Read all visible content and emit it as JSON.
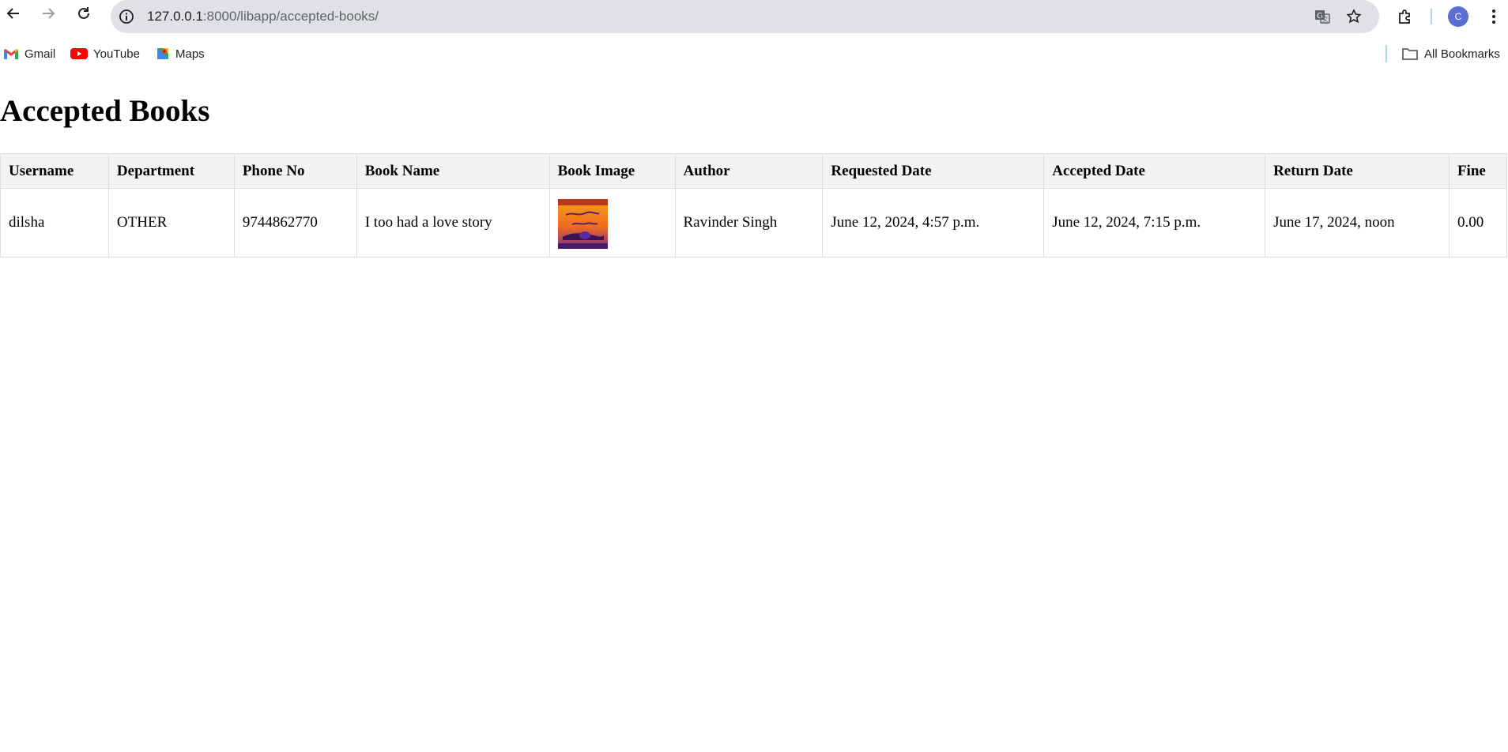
{
  "browser": {
    "url_host": "127.0.0.1",
    "url_path": ":8000/libapp/accepted-books/",
    "avatar_letter": "C",
    "bookmarks": [
      {
        "label": "Gmail",
        "icon": "gmail-icon"
      },
      {
        "label": "YouTube",
        "icon": "youtube-icon"
      },
      {
        "label": "Maps",
        "icon": "maps-icon"
      }
    ],
    "all_bookmarks_label": "All Bookmarks"
  },
  "page": {
    "title": "Accepted Books",
    "table": {
      "headers": [
        "Username",
        "Department",
        "Phone No",
        "Book Name",
        "Book Image",
        "Author",
        "Requested Date",
        "Accepted Date",
        "Return Date",
        "Fine"
      ],
      "rows": [
        {
          "username": "dilsha",
          "department": "OTHER",
          "phone": "9744862770",
          "book_name": "I too had a love story",
          "book_image_icon": "book-cover-image",
          "author": "Ravinder Singh",
          "requested_date": "June 12, 2024, 4:57 p.m.",
          "accepted_date": "June 12, 2024, 7:15 p.m.",
          "return_date": "June 17, 2024, noon",
          "fine": "0.00"
        }
      ]
    }
  },
  "colors": {
    "header_bg": "#f2f2f2",
    "border": "#dddddd",
    "omnibox_bg": "#dfe1e5",
    "avatar_bg": "#5b6ed4"
  }
}
